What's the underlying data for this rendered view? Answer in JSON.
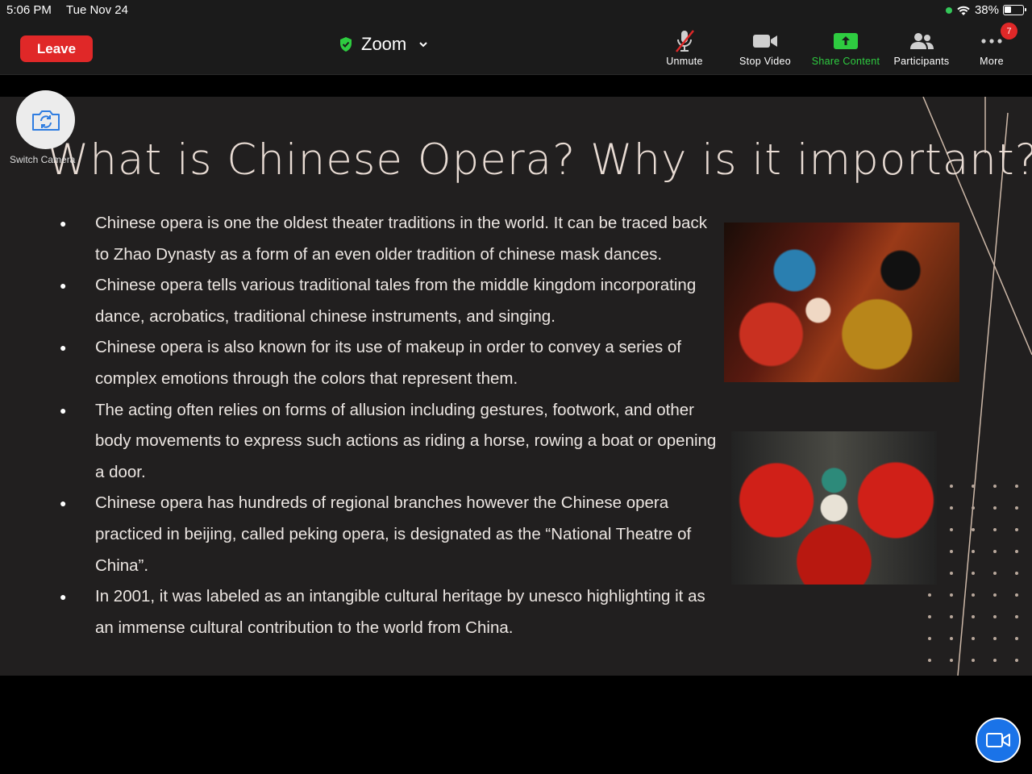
{
  "status_bar": {
    "time": "5:06 PM",
    "date": "Tue Nov 24",
    "battery": "38%"
  },
  "toolbar": {
    "leave_label": "Leave",
    "meeting_title": "Zoom",
    "unmute_label": "Unmute",
    "stop_video_label": "Stop Video",
    "share_content_label": "Share Content",
    "participants_label": "Participants",
    "more_label": "More",
    "more_badge": "7"
  },
  "slide": {
    "title": "What is Chinese Opera? Why is it important?",
    "bullets": [
      "Chinese opera is one the oldest theater traditions in the world. It can be traced back to Zhao Dynasty as a form of an even older tradition of chinese mask dances.",
      "Chinese opera tells various traditional tales from the middle kingdom incorporating dance, acrobatics, traditional chinese instruments, and singing.",
      "Chinese opera is also known for its use of makeup in order to convey a series of complex emotions through the colors that represent them.",
      "The acting often relies on forms of allusion including gestures, footwork, and other body movements to express such actions as riding a horse, rowing a boat or opening a door.",
      "Chinese opera has hundreds of regional branches however the Chinese opera practiced in beijing, called peking opera, is designated as the “National Theatre of China”.",
      " In 2001, it was labeled as an intangible cultural heritage by unesco highlighting it as an immense cultural contribution to the world from China."
    ]
  },
  "camera": {
    "switch_label": "Switch Camera"
  },
  "colors": {
    "leave": "#e02828",
    "share": "#2ecc40",
    "slide_bg": "#211f1f",
    "accent": "#e9dcd4"
  }
}
